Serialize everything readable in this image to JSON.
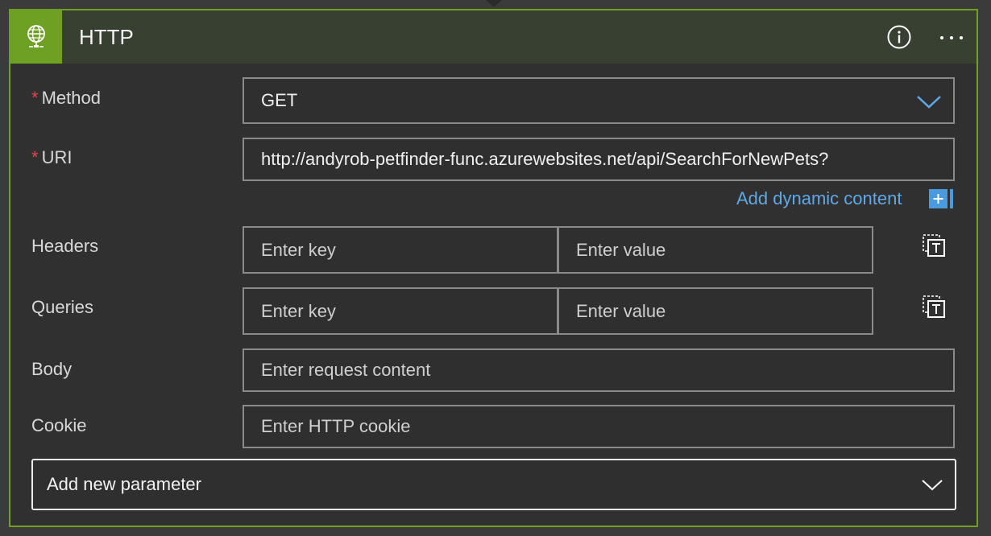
{
  "header": {
    "title": "HTTP",
    "accent_color": "#6ea024",
    "connector_icon": "globe-network-icon",
    "info_icon": "info-icon",
    "more_icon": "ellipsis-icon"
  },
  "fields": {
    "method": {
      "label": "Method",
      "required_marker": "*",
      "value": "GET"
    },
    "uri": {
      "label": "URI",
      "required_marker": "*",
      "value": "http://andyrob-petfinder-func.azurewebsites.net/api/SearchForNewPets?"
    },
    "dynamic_content": {
      "label": "Add dynamic content",
      "icon": "plus-icon"
    },
    "headers": {
      "label": "Headers",
      "key_placeholder": "Enter key",
      "value_placeholder": "Enter value",
      "icon": "switch-to-text-mode-icon"
    },
    "queries": {
      "label": "Queries",
      "key_placeholder": "Enter key",
      "value_placeholder": "Enter value",
      "icon": "switch-to-text-mode-icon"
    },
    "body": {
      "label": "Body",
      "placeholder": "Enter request content"
    },
    "cookie": {
      "label": "Cookie",
      "placeholder": "Enter HTTP cookie"
    }
  },
  "add_parameter": {
    "label": "Add new parameter"
  }
}
